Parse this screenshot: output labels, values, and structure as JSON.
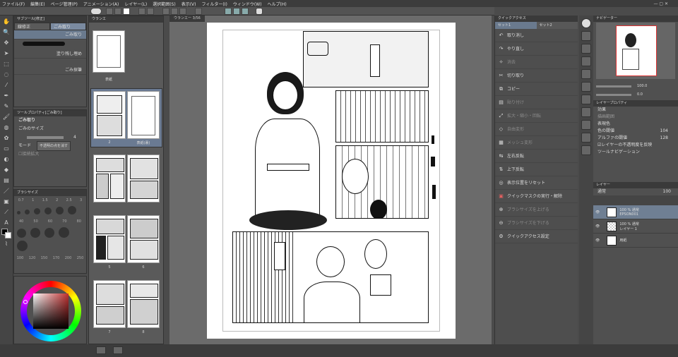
{
  "menu": [
    "ファイル(F)",
    "編集(E)",
    "ページ管理(P)",
    "アニメーション(A)",
    "レイヤー(L)",
    "選択範囲(S)",
    "表示(V)",
    "フィルター(I)",
    "ウィンドウ(W)",
    "ヘルプ(H)"
  ],
  "subtool_panel": {
    "title": "サブツール[修正]",
    "tabs": [
      "線修正",
      "ごみ取り"
    ],
    "items": [
      "ごみ取り",
      "塗り残し埋め",
      "ごみ探筆"
    ]
  },
  "tool_property": {
    "title": "ツールプロパティ[ごみ取り]",
    "name": "ごみ取り",
    "size_label": "ごみのサイズ",
    "size_value": "4",
    "mode_label": "モード",
    "mode_value": "不透明の点を消す",
    "option_label": "接続拡大"
  },
  "brush_size": {
    "title": "ブラシサイズ",
    "row1": [
      "0.7",
      "1",
      "1.5",
      "2",
      "2.5",
      "3"
    ],
    "row2": [
      "40",
      "50",
      "60",
      "70",
      "80"
    ],
    "row3": [
      "100",
      "120",
      "150",
      "170",
      "200",
      "250"
    ]
  },
  "color_wheel": {
    "accent_color": "#c03030"
  },
  "page_manager": {
    "title": "ウランエ",
    "labels": [
      "表紙",
      "1",
      "2",
      "3",
      "4",
      "5",
      "6",
      "7",
      "8"
    ],
    "spread_labels": [
      "表紙",
      "2",
      "表紙(裏)"
    ]
  },
  "canvas": {
    "tab_label": "ウランエー 3/56"
  },
  "quick_access": {
    "title": "クイックアクセス",
    "tabs": [
      "セット1",
      "セット2"
    ],
    "items": [
      {
        "label": "取り消し",
        "icon": "undo-icon",
        "enabled": true
      },
      {
        "label": "やり直し",
        "icon": "redo-icon",
        "enabled": true
      },
      {
        "label": "消去",
        "icon": "erase-icon",
        "enabled": false
      },
      {
        "label": "切り取り",
        "icon": "cut-icon",
        "enabled": true
      },
      {
        "label": "コピー",
        "icon": "copy-icon",
        "enabled": true
      },
      {
        "label": "貼り付け",
        "icon": "paste-icon",
        "enabled": false
      },
      {
        "label": "拡大・縮小・回転",
        "icon": "scale-icon",
        "enabled": false
      },
      {
        "label": "自由変形",
        "icon": "free-transform-icon",
        "enabled": false
      },
      {
        "label": "メッシュ変形",
        "icon": "mesh-icon",
        "enabled": false
      },
      {
        "label": "左右反転",
        "icon": "flip-h-icon",
        "enabled": true
      },
      {
        "label": "上下反転",
        "icon": "flip-v-icon",
        "enabled": true
      },
      {
        "label": "表示位置をリセット",
        "icon": "reset-view-icon",
        "enabled": true
      },
      {
        "label": "クイックマスクの実行・解除",
        "icon": "quick-mask-icon",
        "enabled": true
      },
      {
        "label": "ブラシサイズを上げる",
        "icon": "brush-up-icon",
        "enabled": false
      },
      {
        "label": "ブラシサイズを下げる",
        "icon": "brush-down-icon",
        "enabled": false
      },
      {
        "label": "クイックアクセス設定",
        "icon": "settings-icon",
        "enabled": true
      }
    ]
  },
  "navigator": {
    "title": "ナビゲーター",
    "zoom": "100.0",
    "rotate": "0.0"
  },
  "layer_property": {
    "title": "レイヤープロパティ",
    "effect_label": "効果",
    "display_range_label": "描画範囲",
    "express_color_label": "表現色",
    "color_label": "色の閾値",
    "color_value": "104",
    "alpha_label": "アルファの閾値",
    "alpha_value": "128",
    "reflect_label": "レイヤーの不透明度を反映",
    "tool_nav_label": "ツールナビゲーション"
  },
  "layers": {
    "title": "レイヤー",
    "blend_mode": "通常",
    "opacity": "100",
    "items": [
      {
        "name": "EPSON001",
        "info": "100 % 通常",
        "selected": true
      },
      {
        "name": "レイヤー 1",
        "info": "100 % 通常",
        "selected": false
      },
      {
        "name": "用紙",
        "info": "",
        "selected": false
      }
    ]
  }
}
